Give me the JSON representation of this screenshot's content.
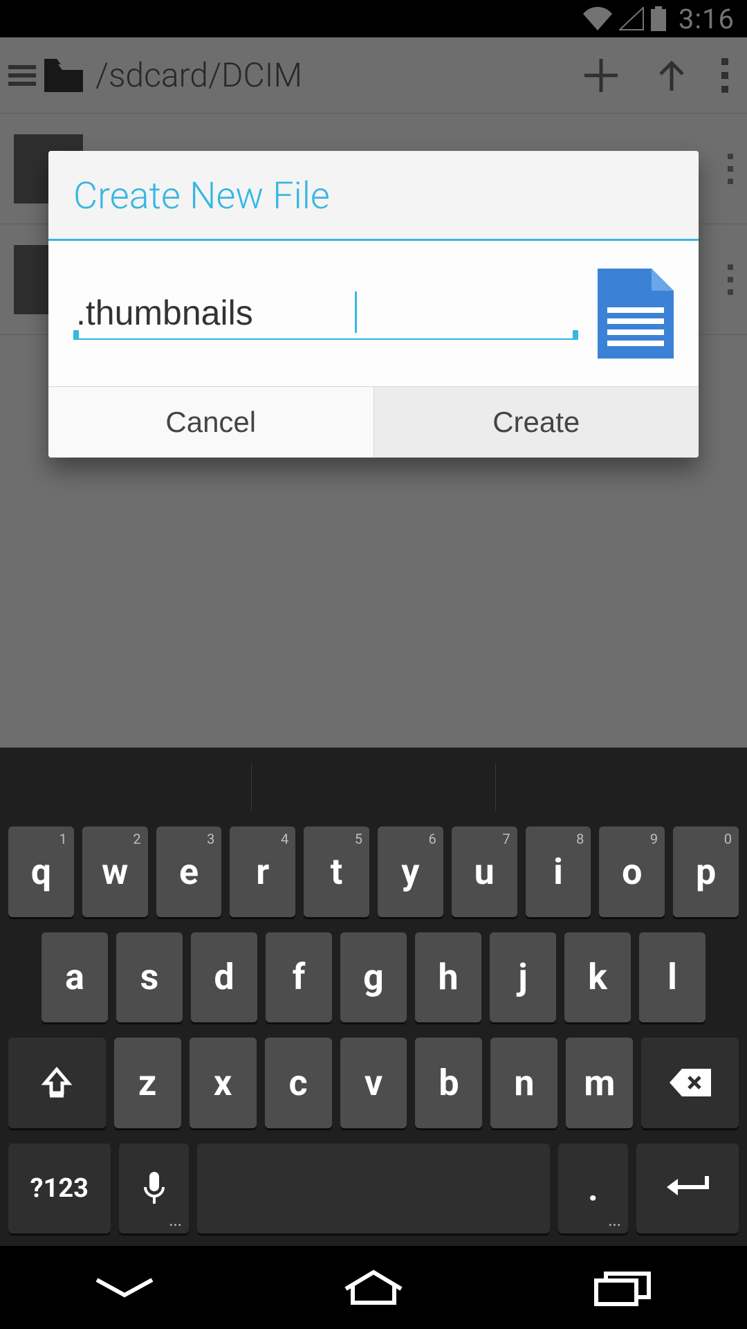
{
  "status": {
    "time": "3:16"
  },
  "appbar": {
    "path": "/sdcard/DCIM"
  },
  "dialog": {
    "title": "Create New File",
    "filename": ".thumbnails",
    "cancel": "Cancel",
    "create": "Create"
  },
  "keyboard": {
    "numbers": [
      "1",
      "2",
      "3",
      "4",
      "5",
      "6",
      "7",
      "8",
      "9",
      "0"
    ],
    "row1": [
      "q",
      "w",
      "e",
      "r",
      "t",
      "y",
      "u",
      "i",
      "o",
      "p"
    ],
    "row2": [
      "a",
      "s",
      "d",
      "f",
      "g",
      "h",
      "j",
      "k",
      "l"
    ],
    "row3": [
      "z",
      "x",
      "c",
      "v",
      "b",
      "n",
      "m"
    ],
    "symKey": "?123",
    "period": "."
  }
}
